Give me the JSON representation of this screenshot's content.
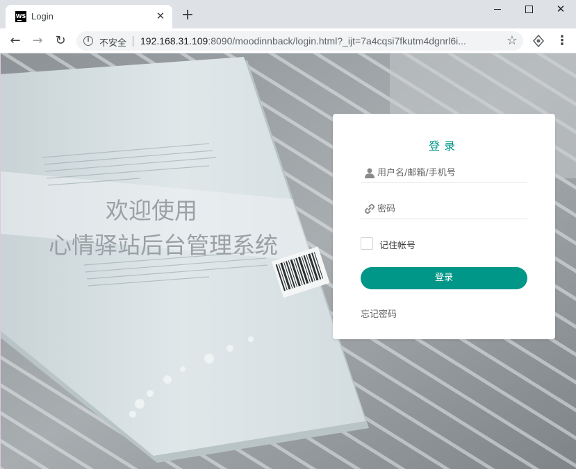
{
  "browser": {
    "tab_title": "Login",
    "favicon_text": "WS",
    "tab_close": "✕",
    "new_tab": "+",
    "window_close": "✕",
    "security_label": "不安全",
    "url_host": "192.168.31.109",
    "url_rest": ":8090/moodinnback/login.html?_ijt=7a4cqsi7fkutm4dgnrl6i...",
    "nav_back": "←",
    "nav_forward": "→",
    "nav_reload": "↻",
    "bookmark": "☆",
    "menu": "⋮"
  },
  "page": {
    "welcome_line1": "欢迎使用",
    "welcome_line2": "心情驿站后台管理系统",
    "login_form": {
      "title": "登录",
      "username_placeholder": "用户名/邮箱/手机号",
      "password_placeholder": "密码",
      "remember_label": "记住帐号",
      "remember_checked": false,
      "submit_label": "登录",
      "forgot_label": "忘记密码"
    }
  },
  "colors": {
    "accent": "#009688",
    "card_bg": "#ffffff"
  }
}
